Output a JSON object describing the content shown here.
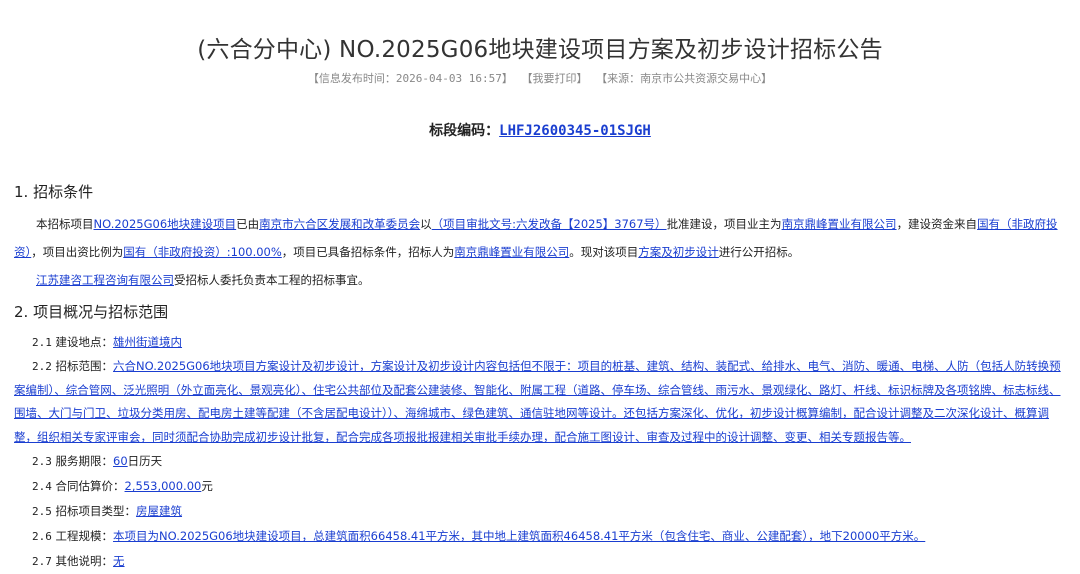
{
  "title": "(六合分中心) NO.2025G06地块建设项目方案及初步设计招标公告",
  "meta": {
    "publish": "【信息发布时间：2026-04-03 16:57】",
    "print": "【我要打印】",
    "source": "【来源：南京市公共资源交易中心】"
  },
  "section_code": {
    "label": "标段编码：",
    "value": "LHFJ2600345-01SJGH"
  },
  "s1": {
    "heading": "1.  招标条件",
    "p1": {
      "t1": "本招标项目",
      "l1": "NO.2025G06地块建设项目",
      "t2": "已由",
      "l2": "南京市六合区发展和改革委员会",
      "t3": "以",
      "l3": "（项目审批文号:六发改备【2025】3767号）",
      "t4": "批准建设，项目业主为",
      "l4": "南京鼎峰置业有限公司",
      "t5": "，建设资金来自",
      "l5": "国有（非政府投资）",
      "t6": "，项目出资比例为",
      "l6": "国有（非政府投资）:100.00%",
      "t7": "，项目已具备招标条件，招标人为",
      "l7": "南京鼎峰置业有限公司",
      "t8": "。现对该项目",
      "l8": "方案及初步设计",
      "t9": "进行公开招标。"
    },
    "p2": {
      "l1": "江苏建咨工程咨询有限公司",
      "t1": "受招标人委托负责本工程的招标事宜。"
    }
  },
  "s2": {
    "heading": "2.  项目概况与招标范围",
    "i1": {
      "num": "2.1",
      "label": " 建设地点：",
      "value": "雄州街道境内"
    },
    "i2": {
      "num": "2.2",
      "label": " 招标范围：",
      "value": "六合NO.2025G06地块项目方案设计及初步设计，方案设计及初步设计内容包括但不限于：项目的桩基、建筑、结构、装配式、给排水、电气、消防、暖通、电梯、人防（包括人防转换预案编制）、综合管网、泛光照明（外立面亮化、景观亮化）、住宅公共部位及配套公建装修、智能化、附属工程（道路、停车场、综合管线、雨污水、景观绿化、路灯、杆线、标识标牌及各项铭牌、标志标线、围墙、大门与门卫、垃圾分类用房、配电房土建等配建（不含居配电设计））、海绵城市、绿色建筑、通信驻地网等设计。还包括方案深化、优化，初步设计概算编制，配合设计调整及二次深化设计、概算调整，组织相关专家评审会，同时须配合协助完成初步设计批复，配合完成各项报批报建相关审批手续办理，配合施工图设计、审查及过程中的设计调整、变更、相关专题报告等。"
    },
    "i3": {
      "num": "2.3",
      "label": " 服务期限：",
      "value": "60",
      "suffix": "日历天"
    },
    "i4": {
      "num": "2.4",
      "label": " 合同估算价：",
      "value": "2,553,000.00",
      "suffix": "元"
    },
    "i5": {
      "num": "2.5",
      "label": " 招标项目类型：",
      "value": "房屋建筑"
    },
    "i6": {
      "num": "2.6",
      "label": " 工程规模：",
      "value": "本项目为NO.2025G06地块建设项目，总建筑面积66458.41平方米，其中地上建筑面积46458.41平方米（包含住宅、商业、公建配套），地下20000平方米。"
    },
    "i7": {
      "num": "2.7",
      "label": " 其他说明：",
      "value": "无"
    }
  }
}
